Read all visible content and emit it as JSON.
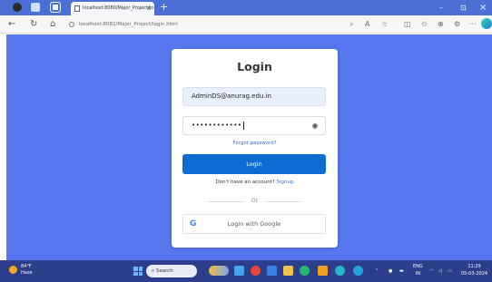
{
  "browser": {
    "tab_title": "localhost:8080/Major_Project/lo",
    "tab_close": "x",
    "new_tab": "+",
    "window_controls": {
      "minimize": "–",
      "maximize": "⊡",
      "close": "×"
    },
    "address_url": "localhost:8082/Major_Project/login.html",
    "toolbar_icons": [
      "back-icon",
      "refresh-icon",
      "home-icon",
      "zoom-icon",
      "read-aloud-icon",
      "favorite-icon",
      "split-screen-icon",
      "favorites-list-icon",
      "collections-icon",
      "extensions-icon",
      "more-icon"
    ]
  },
  "colors": {
    "page_background": "#5877ef",
    "tabstrip": "#4b6fd6",
    "primary_button": "#0d6bd2",
    "link": "#2f6cd8",
    "taskbar": "#2d3e8c"
  },
  "login": {
    "title": "Login",
    "email_value": "AdminDS@anurag.edu.in",
    "password_mask": "••••••••••••",
    "forgot_password": "Forgot password?",
    "login_button": "Login",
    "no_account_text": "Don't have an account?",
    "signup_link": "Signup",
    "divider_text": "Or",
    "google_button": "Login with Google",
    "google_logo": "G"
  },
  "taskbar": {
    "weather_temp": "84°F",
    "weather_desc": "Haze",
    "search_placeholder": "Search",
    "language_top": "ENG",
    "language_bottom": "IN",
    "time": "11:29",
    "date": "05-03-2024"
  }
}
